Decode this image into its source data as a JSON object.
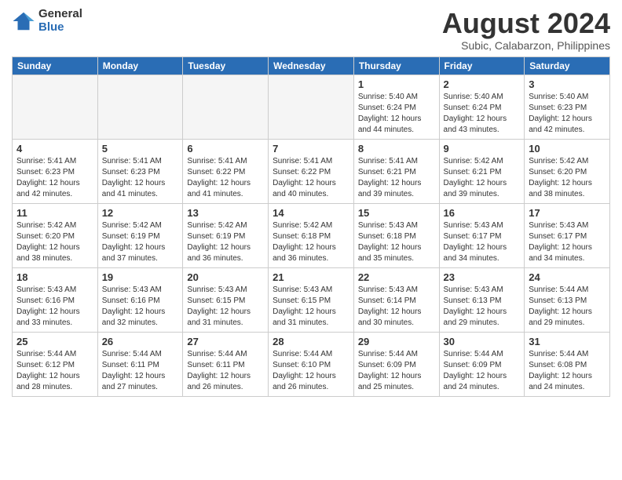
{
  "header": {
    "logo_general": "General",
    "logo_blue": "Blue",
    "title": "August 2024",
    "subtitle": "Subic, Calabarzon, Philippines"
  },
  "weekdays": [
    "Sunday",
    "Monday",
    "Tuesday",
    "Wednesday",
    "Thursday",
    "Friday",
    "Saturday"
  ],
  "weeks": [
    [
      {
        "day": "",
        "info": "",
        "empty": true
      },
      {
        "day": "",
        "info": "",
        "empty": true
      },
      {
        "day": "",
        "info": "",
        "empty": true
      },
      {
        "day": "",
        "info": "",
        "empty": true
      },
      {
        "day": "1",
        "info": "Sunrise: 5:40 AM\nSunset: 6:24 PM\nDaylight: 12 hours\nand 44 minutes."
      },
      {
        "day": "2",
        "info": "Sunrise: 5:40 AM\nSunset: 6:24 PM\nDaylight: 12 hours\nand 43 minutes."
      },
      {
        "day": "3",
        "info": "Sunrise: 5:40 AM\nSunset: 6:23 PM\nDaylight: 12 hours\nand 42 minutes."
      }
    ],
    [
      {
        "day": "4",
        "info": "Sunrise: 5:41 AM\nSunset: 6:23 PM\nDaylight: 12 hours\nand 42 minutes."
      },
      {
        "day": "5",
        "info": "Sunrise: 5:41 AM\nSunset: 6:23 PM\nDaylight: 12 hours\nand 41 minutes."
      },
      {
        "day": "6",
        "info": "Sunrise: 5:41 AM\nSunset: 6:22 PM\nDaylight: 12 hours\nand 41 minutes."
      },
      {
        "day": "7",
        "info": "Sunrise: 5:41 AM\nSunset: 6:22 PM\nDaylight: 12 hours\nand 40 minutes."
      },
      {
        "day": "8",
        "info": "Sunrise: 5:41 AM\nSunset: 6:21 PM\nDaylight: 12 hours\nand 39 minutes."
      },
      {
        "day": "9",
        "info": "Sunrise: 5:42 AM\nSunset: 6:21 PM\nDaylight: 12 hours\nand 39 minutes."
      },
      {
        "day": "10",
        "info": "Sunrise: 5:42 AM\nSunset: 6:20 PM\nDaylight: 12 hours\nand 38 minutes."
      }
    ],
    [
      {
        "day": "11",
        "info": "Sunrise: 5:42 AM\nSunset: 6:20 PM\nDaylight: 12 hours\nand 38 minutes."
      },
      {
        "day": "12",
        "info": "Sunrise: 5:42 AM\nSunset: 6:19 PM\nDaylight: 12 hours\nand 37 minutes."
      },
      {
        "day": "13",
        "info": "Sunrise: 5:42 AM\nSunset: 6:19 PM\nDaylight: 12 hours\nand 36 minutes."
      },
      {
        "day": "14",
        "info": "Sunrise: 5:42 AM\nSunset: 6:18 PM\nDaylight: 12 hours\nand 36 minutes."
      },
      {
        "day": "15",
        "info": "Sunrise: 5:43 AM\nSunset: 6:18 PM\nDaylight: 12 hours\nand 35 minutes."
      },
      {
        "day": "16",
        "info": "Sunrise: 5:43 AM\nSunset: 6:17 PM\nDaylight: 12 hours\nand 34 minutes."
      },
      {
        "day": "17",
        "info": "Sunrise: 5:43 AM\nSunset: 6:17 PM\nDaylight: 12 hours\nand 34 minutes."
      }
    ],
    [
      {
        "day": "18",
        "info": "Sunrise: 5:43 AM\nSunset: 6:16 PM\nDaylight: 12 hours\nand 33 minutes."
      },
      {
        "day": "19",
        "info": "Sunrise: 5:43 AM\nSunset: 6:16 PM\nDaylight: 12 hours\nand 32 minutes."
      },
      {
        "day": "20",
        "info": "Sunrise: 5:43 AM\nSunset: 6:15 PM\nDaylight: 12 hours\nand 31 minutes."
      },
      {
        "day": "21",
        "info": "Sunrise: 5:43 AM\nSunset: 6:15 PM\nDaylight: 12 hours\nand 31 minutes."
      },
      {
        "day": "22",
        "info": "Sunrise: 5:43 AM\nSunset: 6:14 PM\nDaylight: 12 hours\nand 30 minutes."
      },
      {
        "day": "23",
        "info": "Sunrise: 5:43 AM\nSunset: 6:13 PM\nDaylight: 12 hours\nand 29 minutes."
      },
      {
        "day": "24",
        "info": "Sunrise: 5:44 AM\nSunset: 6:13 PM\nDaylight: 12 hours\nand 29 minutes."
      }
    ],
    [
      {
        "day": "25",
        "info": "Sunrise: 5:44 AM\nSunset: 6:12 PM\nDaylight: 12 hours\nand 28 minutes."
      },
      {
        "day": "26",
        "info": "Sunrise: 5:44 AM\nSunset: 6:11 PM\nDaylight: 12 hours\nand 27 minutes."
      },
      {
        "day": "27",
        "info": "Sunrise: 5:44 AM\nSunset: 6:11 PM\nDaylight: 12 hours\nand 26 minutes."
      },
      {
        "day": "28",
        "info": "Sunrise: 5:44 AM\nSunset: 6:10 PM\nDaylight: 12 hours\nand 26 minutes."
      },
      {
        "day": "29",
        "info": "Sunrise: 5:44 AM\nSunset: 6:09 PM\nDaylight: 12 hours\nand 25 minutes."
      },
      {
        "day": "30",
        "info": "Sunrise: 5:44 AM\nSunset: 6:09 PM\nDaylight: 12 hours\nand 24 minutes."
      },
      {
        "day": "31",
        "info": "Sunrise: 5:44 AM\nSunset: 6:08 PM\nDaylight: 12 hours\nand 24 minutes."
      }
    ]
  ]
}
